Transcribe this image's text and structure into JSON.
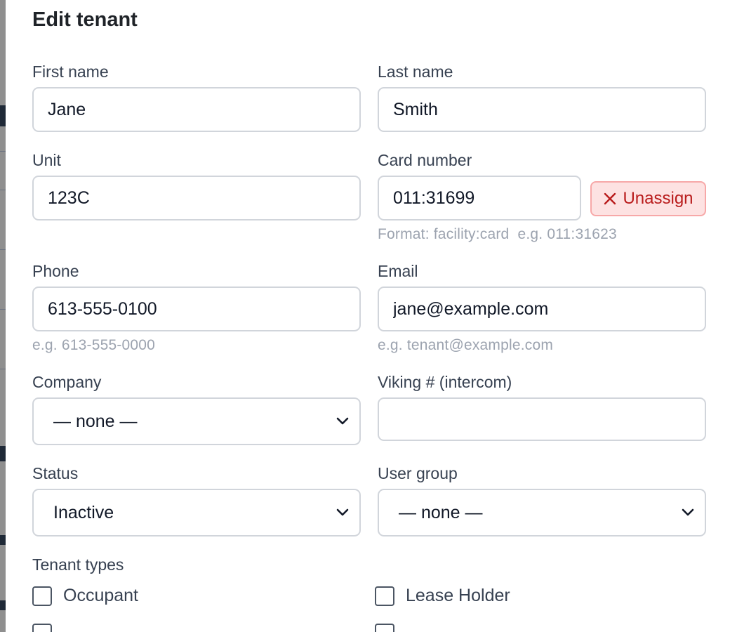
{
  "modal": {
    "title": "Edit tenant"
  },
  "form": {
    "first_name": {
      "label": "First name",
      "value": "Jane"
    },
    "last_name": {
      "label": "Last name",
      "value": "Smith"
    },
    "unit": {
      "label": "Unit",
      "value": "123C"
    },
    "card_number": {
      "label": "Card number",
      "value": "011:31699",
      "hint": "Format: facility:card  e.g. 011:31623",
      "unassign_label": "Unassign"
    },
    "phone": {
      "label": "Phone",
      "value": "613-555-0100",
      "hint": "e.g. 613-555-0000"
    },
    "email": {
      "label": "Email",
      "value": "jane@example.com",
      "hint": "e.g. tenant@example.com"
    },
    "company": {
      "label": "Company",
      "selected": "— none —"
    },
    "viking": {
      "label": "Viking # (intercom)",
      "value": ""
    },
    "status": {
      "label": "Status",
      "selected": "Inactive"
    },
    "user_group": {
      "label": "User group",
      "selected": "— none —"
    },
    "tenant_types": {
      "label": "Tenant types",
      "options": [
        {
          "label": "Occupant",
          "checked": false
        },
        {
          "label": "Lease Holder",
          "checked": false
        }
      ]
    }
  },
  "colors": {
    "unassign_bg": "#fde2e2",
    "unassign_text": "#b91c1c",
    "border": "#d1d5db",
    "hint": "#9ca3af"
  }
}
